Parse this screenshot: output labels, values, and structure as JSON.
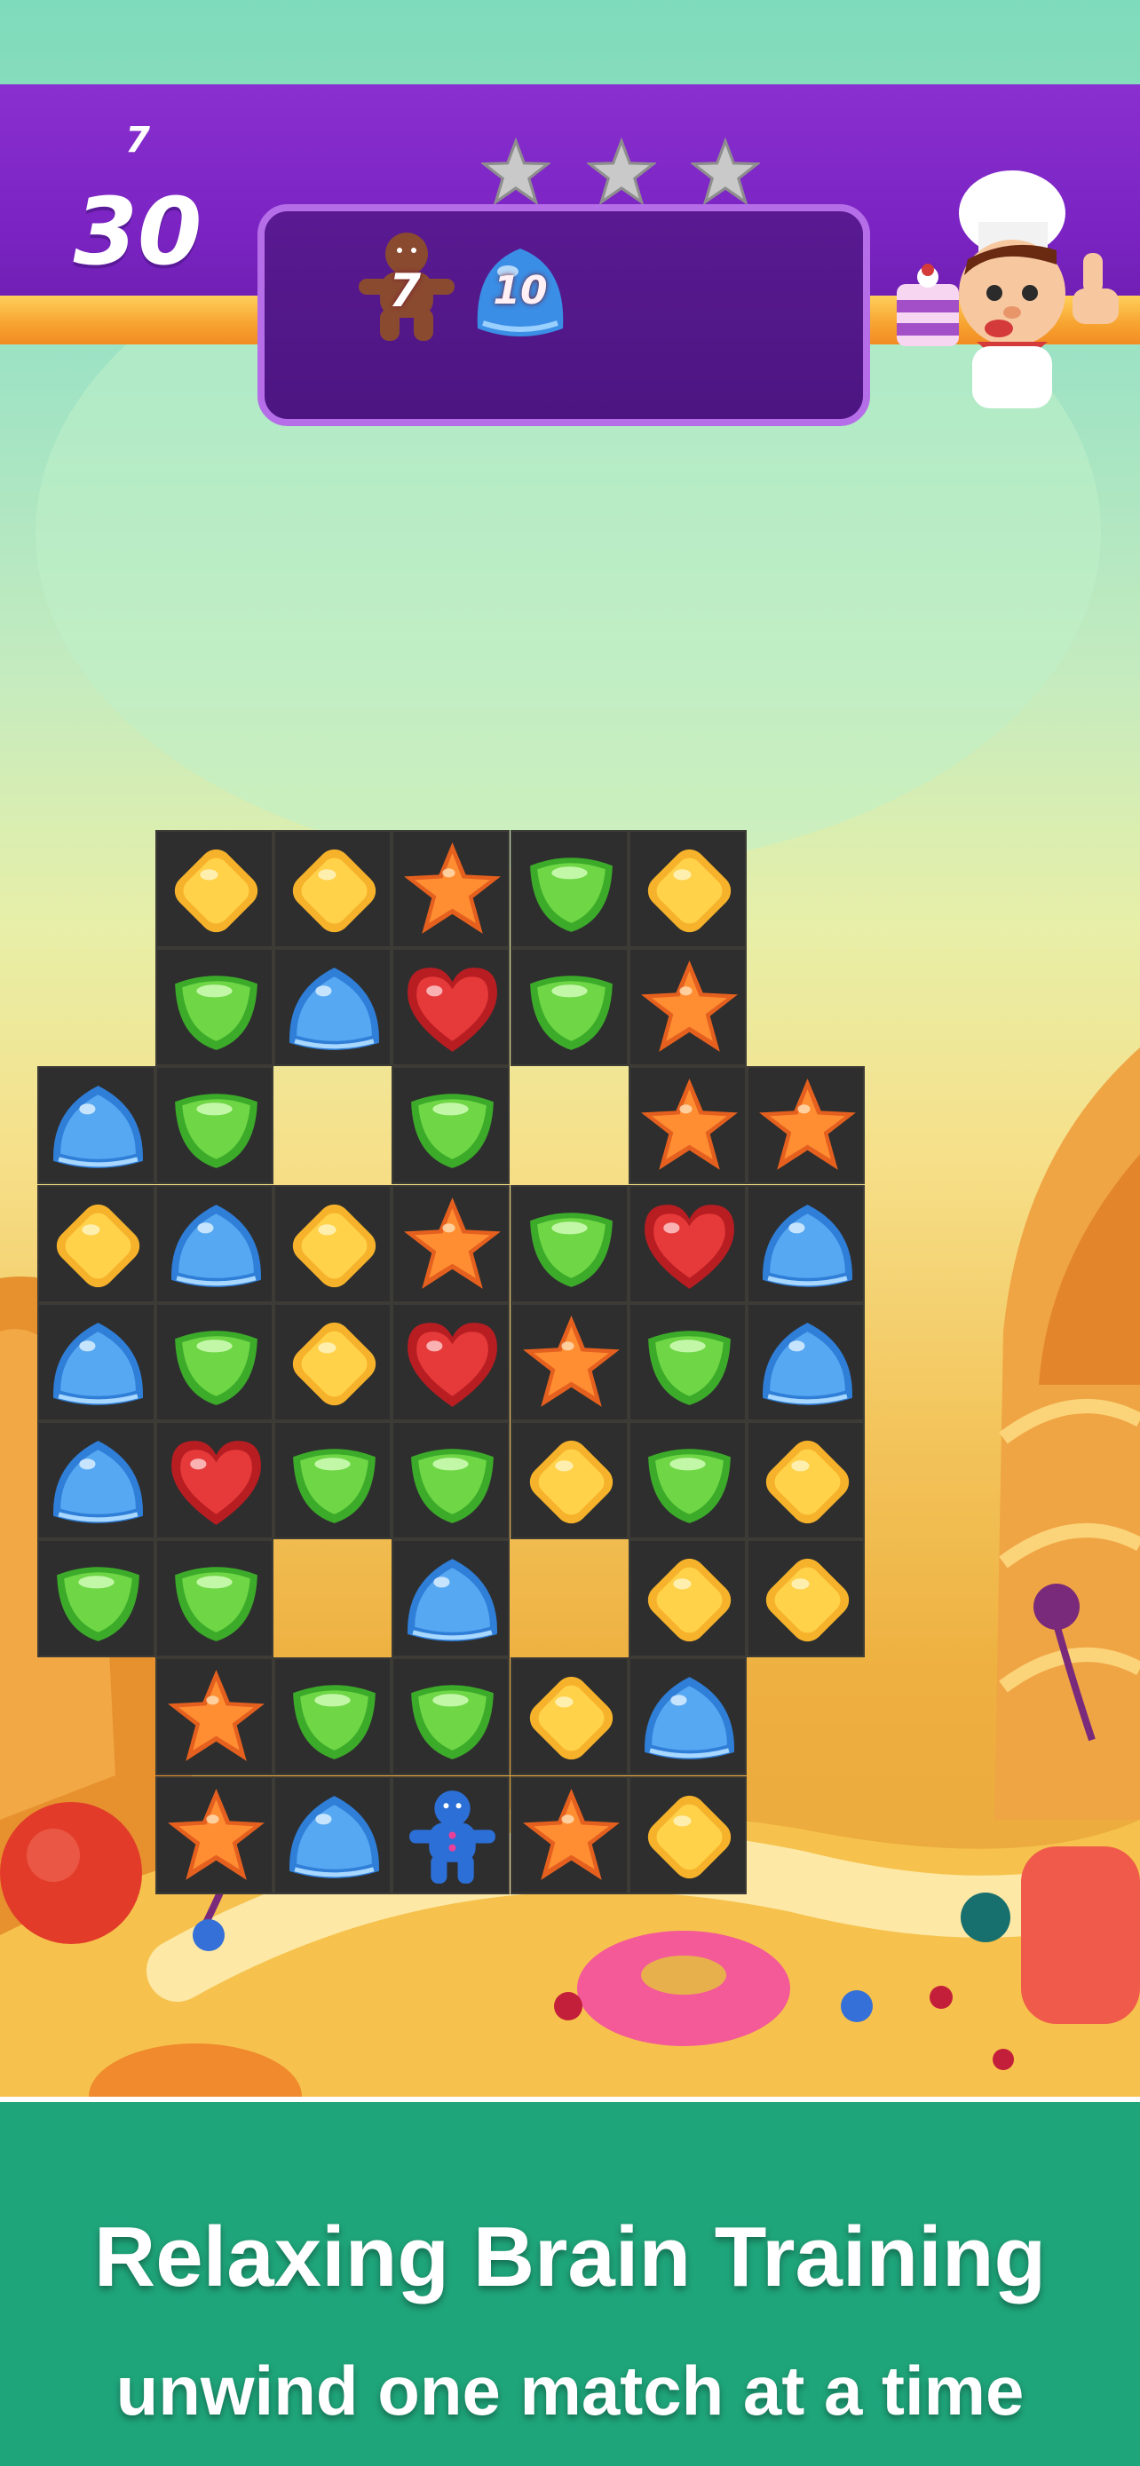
{
  "hud": {
    "level": "7",
    "moves_left": "30",
    "stars_earned": 0,
    "stars_total": 3,
    "goals": [
      {
        "icon": "gingerbread-icon",
        "count": "7"
      },
      {
        "icon": "blue-gumdrop-icon",
        "count": "10"
      }
    ]
  },
  "board": {
    "columns": 7,
    "rows": 9,
    "legend": {
      "Y": "yellow-diamond",
      "G": "green-gumdrop",
      "B": "blue-gumdrop",
      "O": "orange-star",
      "R": "red-heart",
      "M": "blue-gingerbread",
      ".": "empty"
    },
    "grid": [
      ". Y Y O G Y .",
      ". G B R G O .",
      "B G . G . O O",
      "Y B Y O G R B",
      "B G Y R O G B",
      "B R G G Y G Y",
      "G G . B . Y Y",
      ". O G G Y B .",
      ". O B M O Y ."
    ]
  },
  "colors": {
    "hud_purple": "#7a23c2",
    "banner_green": "#1fa57a"
  },
  "banner": {
    "headline": "Relaxing Brain Training",
    "tagline": "unwind one match at a time"
  }
}
